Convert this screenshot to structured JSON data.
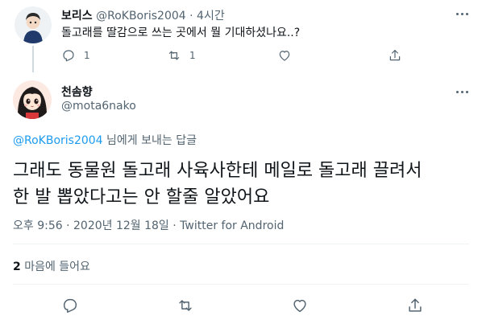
{
  "parent_tweet": {
    "display_name": "보리스",
    "handle": "@RoKBoris2004",
    "separator": "·",
    "time": "4시간",
    "text": "돌고래를 딸감으로 쓰는 곳에서 뭘 기대하셨나요..?",
    "reply_count": "1",
    "retweet_count": "1"
  },
  "main_tweet": {
    "display_name": "천솜향",
    "handle": "@mota6nako",
    "reply_to_mention": "@RoKBoris2004",
    "reply_to_suffix": " 님에게 보내는 답글",
    "text_lines": [
      "그래도 동물원 돌고래 사육사한테 메일로 돌고래 끌려서",
      "한 발 뽑았다고는 안 할줄 알았어요"
    ],
    "timestamp": "오후 9:56 · 2020년 12월 18일 · ",
    "source": "Twitter for Android",
    "likes_count": "2",
    "likes_label": " 마음에 들어요"
  },
  "icons": {
    "reply": "reply-icon",
    "retweet": "retweet-icon",
    "like": "heart-icon",
    "share": "share-icon",
    "more": "more-icon"
  },
  "colors": {
    "text": "#0f1419",
    "secondary": "#536471",
    "link": "#1d9bf0",
    "divider": "#eff3f4"
  }
}
